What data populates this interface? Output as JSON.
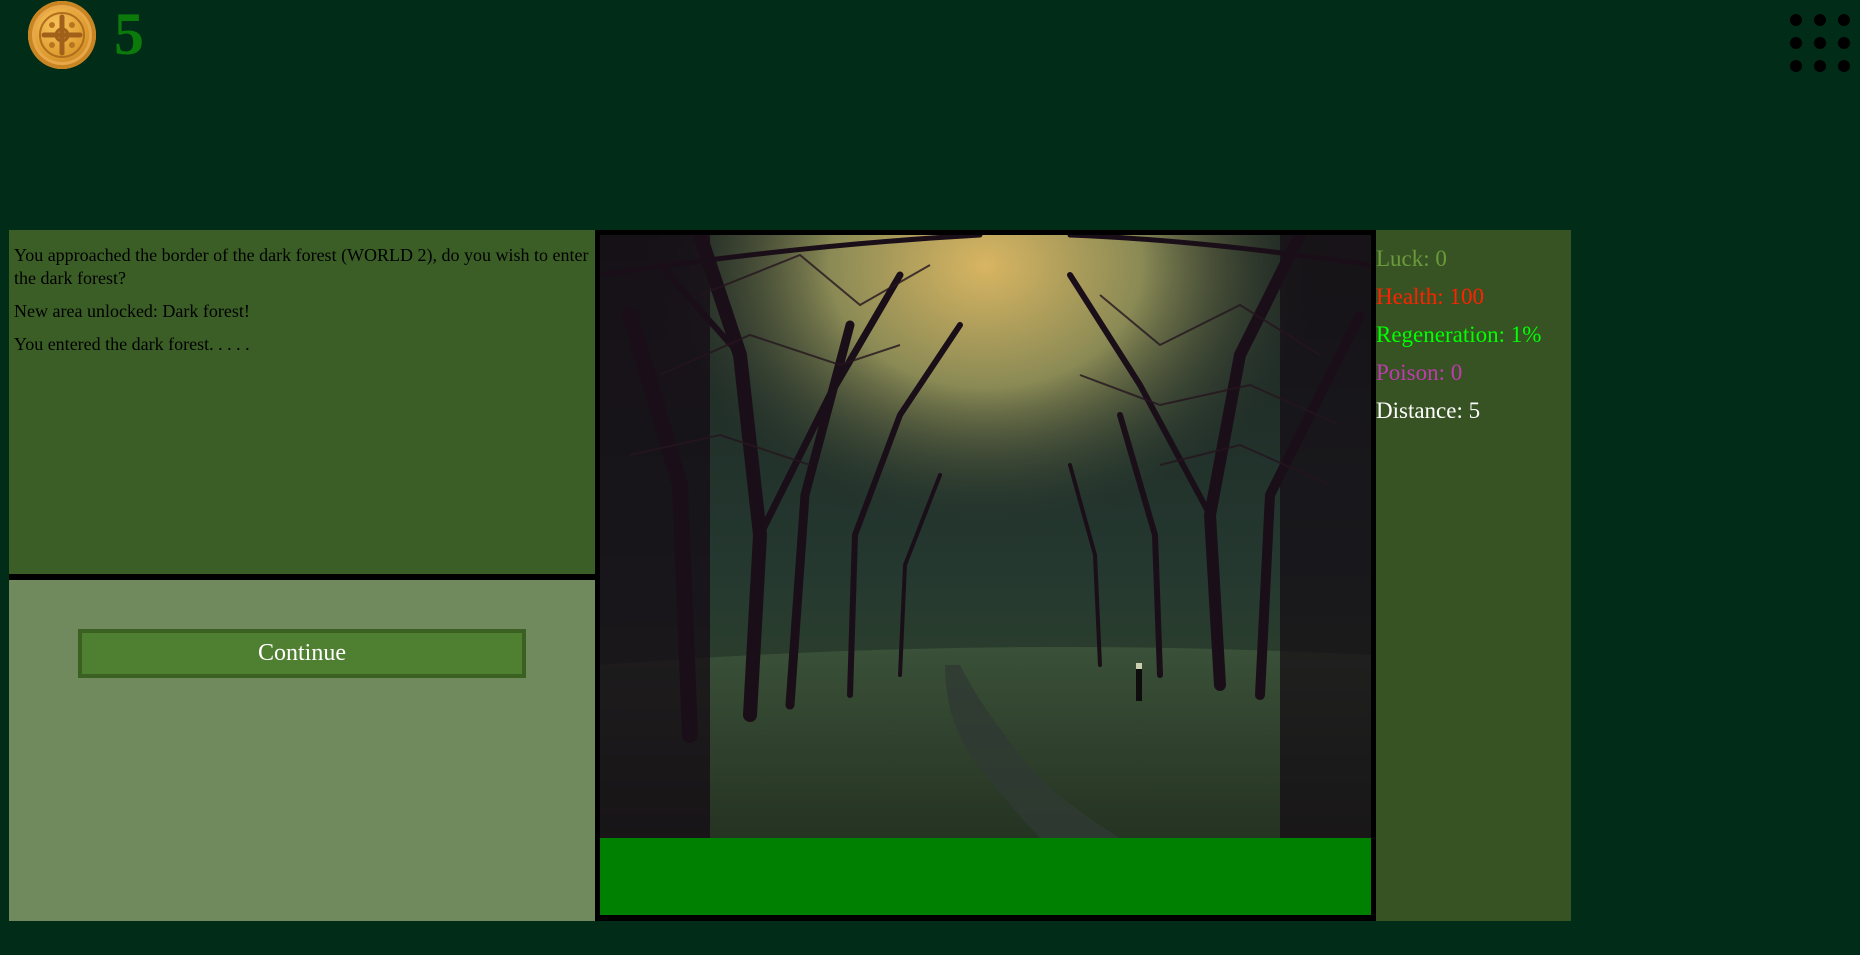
{
  "header": {
    "coin_count": "5"
  },
  "log": {
    "messages": [
      "You approached the border of the dark forest (WORLD 2), do you wish to enter the dark forest?",
      "New area unlocked: Dark forest!",
      "You entered the dark forest. . . . ."
    ]
  },
  "actions": {
    "continue_label": "Continue"
  },
  "scene": {
    "progress_fraction": 1.0
  },
  "stats": {
    "luck": "Luck: 0",
    "health": "Health: 100",
    "regeneration": "Regeneration: 1%",
    "poison": "Poison: 0",
    "distance": "Distance: 5"
  },
  "colors": {
    "background": "#002c18",
    "luck": "#6b9a3c",
    "health": "#ff2200",
    "regeneration": "#00ff00",
    "poison": "#c03ab0",
    "distance": "#ffffff",
    "progress": "#008000"
  },
  "icons": {
    "coin": "gold-coin-icon",
    "menu": "grid-menu-icon"
  }
}
